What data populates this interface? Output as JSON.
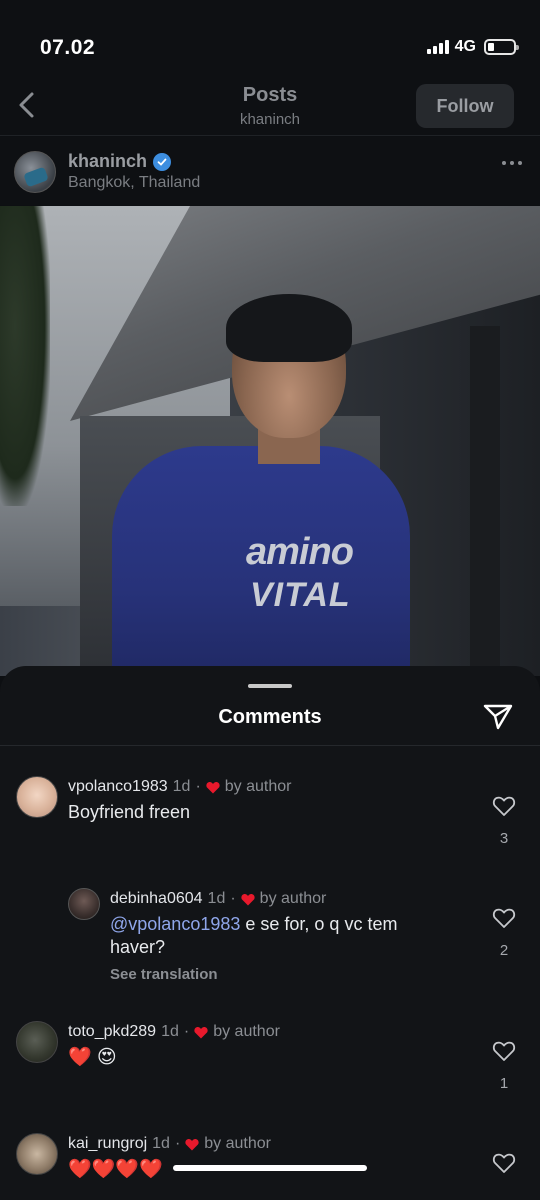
{
  "status": {
    "time": "07.02",
    "network": "4G",
    "battery_level": 0.25
  },
  "header": {
    "title": "Posts",
    "subtitle": "khaninch",
    "follow_label": "Follow"
  },
  "post": {
    "username": "khaninch",
    "location": "Bangkok, Thailand",
    "shirt_line1": "amino",
    "shirt_line2": "VITAL"
  },
  "comments_sheet": {
    "title": "Comments",
    "see_translation": "See translation",
    "comments": [
      {
        "user": "vpolanco1983",
        "time": "1d",
        "sep": "·",
        "liked_by": "by author",
        "text": "Boyfriend freen",
        "likes": "3"
      },
      {
        "user": "debinha0604",
        "time": "1d",
        "sep": "·",
        "liked_by": "by author",
        "mention": "@vpolanco1983",
        "text": " e se for, o q vc tem haver?",
        "likes": "2"
      },
      {
        "user": "toto_pkd289",
        "time": "1d",
        "sep": "·",
        "liked_by": "by author",
        "emojis": "❤️ 😍",
        "likes": "1"
      },
      {
        "user": "kai_rungroj",
        "time": "1d",
        "sep": "·",
        "liked_by": "by author",
        "emojis": "❤️❤️❤️❤️"
      }
    ]
  },
  "colors": {
    "background": "#0d0f12",
    "sheet": "#121417",
    "mention": "#8fa6ea",
    "heart": "#e8192c",
    "verified": "#3d8ee0"
  }
}
